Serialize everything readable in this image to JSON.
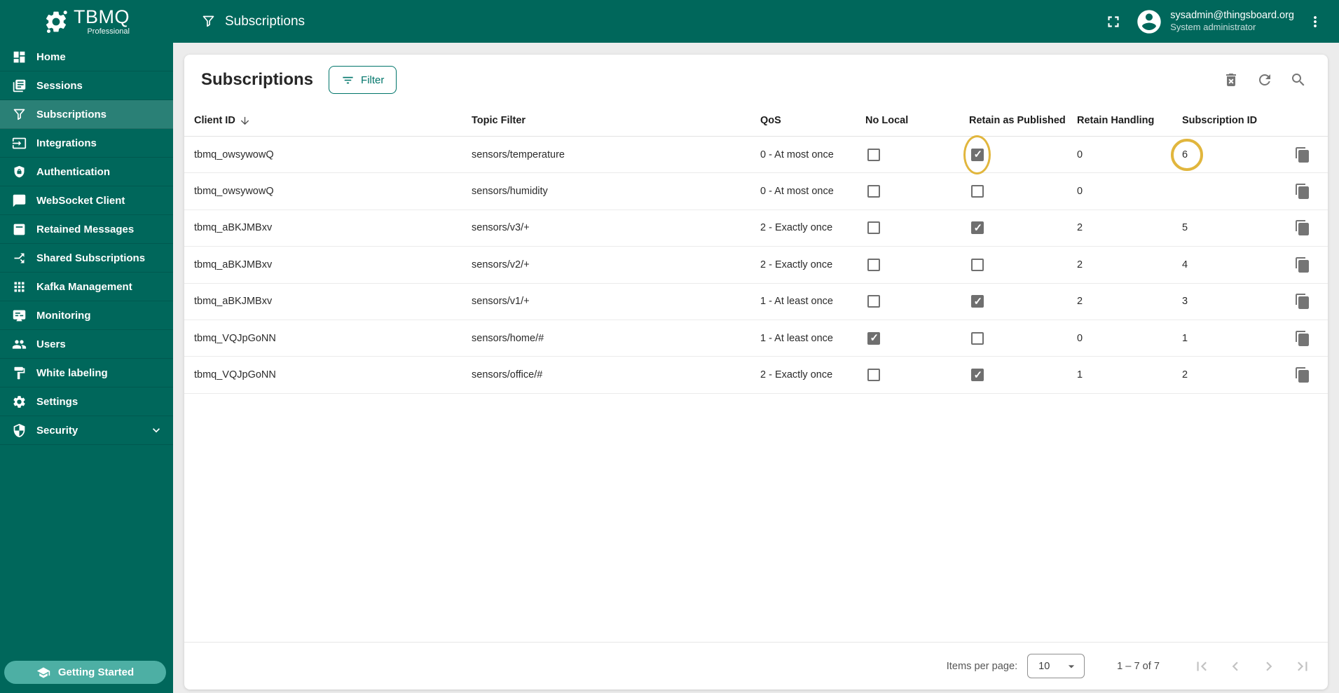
{
  "colors": {
    "bar_teal": "#00675B",
    "selected_teal": "#2A8076",
    "accent_teal": "#00756A",
    "highlight_gold": "#E1B63D"
  },
  "brand": {
    "name": "TBMQ",
    "edition": "Professional"
  },
  "topbar": {
    "title": "Subscriptions",
    "user": {
      "email": "sysadmin@thingsboard.org",
      "role": "System administrator"
    }
  },
  "sidebar": {
    "items": [
      {
        "label": "Home",
        "icon": "dashboard"
      },
      {
        "label": "Sessions",
        "icon": "sessions"
      },
      {
        "label": "Subscriptions",
        "icon": "funnel",
        "selected": true
      },
      {
        "label": "Integrations",
        "icon": "integrations"
      },
      {
        "label": "Authentication",
        "icon": "auth"
      },
      {
        "label": "WebSocket Client",
        "icon": "chat"
      },
      {
        "label": "Retained Messages",
        "icon": "retained"
      },
      {
        "label": "Shared Subscriptions",
        "icon": "shared"
      },
      {
        "label": "Kafka Management",
        "icon": "kafka"
      },
      {
        "label": "Monitoring",
        "icon": "monitoring"
      },
      {
        "label": "Users",
        "icon": "users"
      },
      {
        "label": "White labeling",
        "icon": "white-labeling"
      },
      {
        "label": "Settings",
        "icon": "settings"
      },
      {
        "label": "Security",
        "icon": "security",
        "expandable": true
      }
    ],
    "footer": {
      "label": "Getting Started",
      "icon": "school"
    }
  },
  "content": {
    "title": "Subscriptions",
    "filter_button": "Filter",
    "columns": [
      "Client ID",
      "Topic Filter",
      "QoS",
      "No Local",
      "Retain as Published",
      "Retain Handling",
      "Subscription ID"
    ],
    "rows": [
      {
        "client_id": "tbmq_owsywowQ",
        "topic_filter": "sensors/temperature",
        "qos": "0 - At most once",
        "no_local": false,
        "retain_as_published": true,
        "retain_handling": "0",
        "subscription_id": "6",
        "highlights": {
          "retain_as_published": true,
          "subscription_id": true
        }
      },
      {
        "client_id": "tbmq_owsywowQ",
        "topic_filter": "sensors/humidity",
        "qos": "0 - At most once",
        "no_local": false,
        "retain_as_published": false,
        "retain_handling": "0",
        "subscription_id": ""
      },
      {
        "client_id": "tbmq_aBKJMBxv",
        "topic_filter": "sensors/v3/+",
        "qos": "2 - Exactly once",
        "no_local": false,
        "retain_as_published": true,
        "retain_handling": "2",
        "subscription_id": "5"
      },
      {
        "client_id": "tbmq_aBKJMBxv",
        "topic_filter": "sensors/v2/+",
        "qos": "2 - Exactly once",
        "no_local": false,
        "retain_as_published": false,
        "retain_handling": "2",
        "subscription_id": "4"
      },
      {
        "client_id": "tbmq_aBKJMBxv",
        "topic_filter": "sensors/v1/+",
        "qos": "1 - At least once",
        "no_local": false,
        "retain_as_published": true,
        "retain_handling": "2",
        "subscription_id": "3"
      },
      {
        "client_id": "tbmq_VQJpGoNN",
        "topic_filter": "sensors/home/#",
        "qos": "1 - At least once",
        "no_local": true,
        "retain_as_published": false,
        "retain_handling": "0",
        "subscription_id": "1"
      },
      {
        "client_id": "tbmq_VQJpGoNN",
        "topic_filter": "sensors/office/#",
        "qos": "2 - Exactly once",
        "no_local": false,
        "retain_as_published": true,
        "retain_handling": "1",
        "subscription_id": "2"
      }
    ],
    "pagination": {
      "items_per_page_label": "Items per page:",
      "page_size": "10",
      "range": "1 – 7 of 7"
    }
  }
}
